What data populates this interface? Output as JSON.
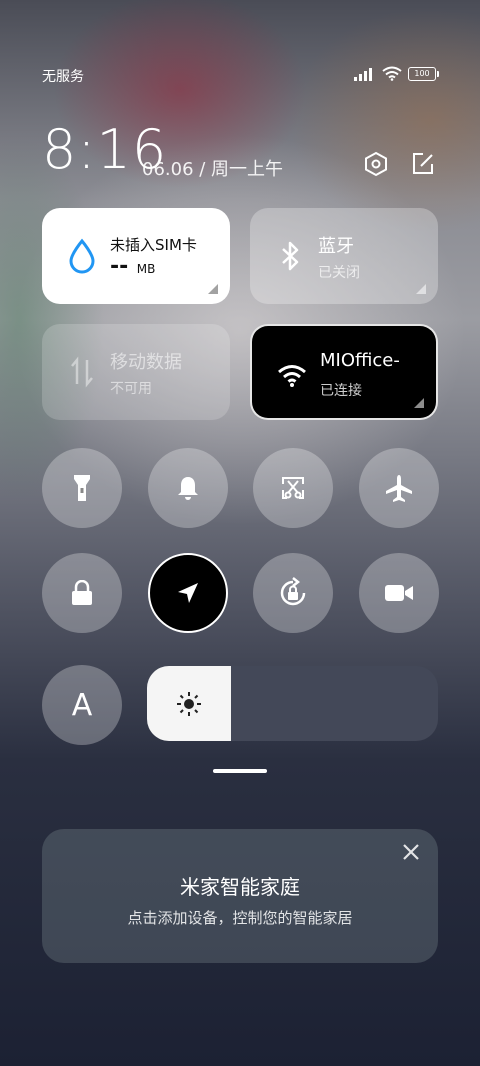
{
  "status_bar": {
    "carrier": "无服务",
    "battery": "100"
  },
  "header": {
    "time": "8:16",
    "date": "06.06 / 周一上午"
  },
  "tiles": {
    "sim": {
      "title": "未插入SIM卡",
      "value": "--",
      "unit": "MB"
    },
    "bluetooth": {
      "title": "蓝牙",
      "sub": "已关闭"
    },
    "mobile_data": {
      "title": "移动数据",
      "sub": "不可用"
    },
    "wifi": {
      "title": "MIOffice-",
      "sub": "已连接"
    }
  },
  "round_toggles_row1": [
    "flashlight-icon",
    "bell-icon",
    "screenshot-scissors-icon",
    "airplane-icon"
  ],
  "round_toggles_row2": [
    "lock-icon",
    "location-icon",
    "rotation-lock-icon",
    "video-camera-icon"
  ],
  "auto_brightness_label": "A",
  "brightness": {
    "level": 0.29
  },
  "smart_home_card": {
    "title": "米家智能家庭",
    "subtitle": "点击添加设备，控制您的智能家居"
  },
  "colors": {
    "accent_blue": "#2196f3",
    "slider_track": "#434858"
  }
}
